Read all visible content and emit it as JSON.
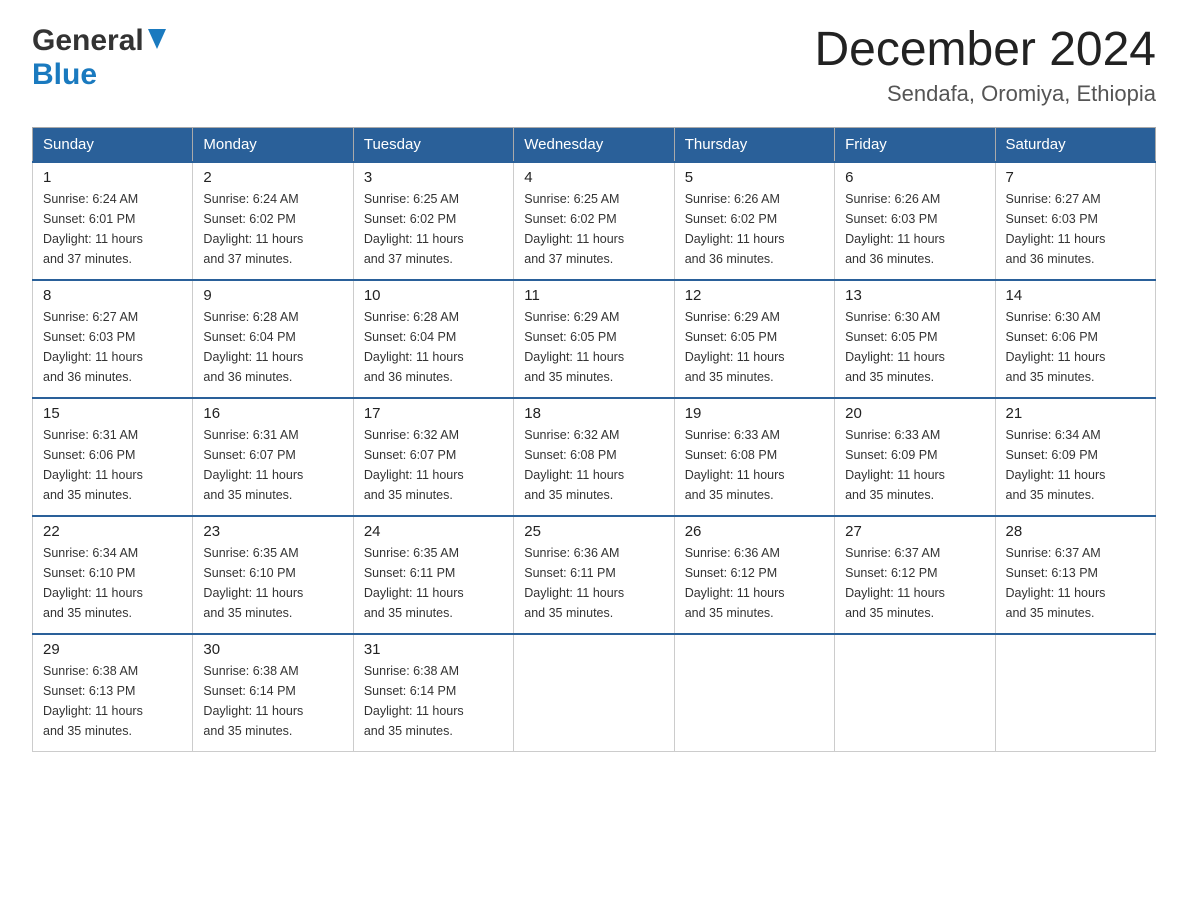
{
  "header": {
    "logo": {
      "general": "General",
      "blue": "Blue",
      "triangle_alt": "triangle logo"
    },
    "month_title": "December 2024",
    "location": "Sendafa, Oromiya, Ethiopia"
  },
  "days_of_week": [
    "Sunday",
    "Monday",
    "Tuesday",
    "Wednesday",
    "Thursday",
    "Friday",
    "Saturday"
  ],
  "weeks": [
    [
      {
        "day": "1",
        "sunrise": "6:24 AM",
        "sunset": "6:01 PM",
        "daylight": "11 hours and 37 minutes."
      },
      {
        "day": "2",
        "sunrise": "6:24 AM",
        "sunset": "6:02 PM",
        "daylight": "11 hours and 37 minutes."
      },
      {
        "day": "3",
        "sunrise": "6:25 AM",
        "sunset": "6:02 PM",
        "daylight": "11 hours and 37 minutes."
      },
      {
        "day": "4",
        "sunrise": "6:25 AM",
        "sunset": "6:02 PM",
        "daylight": "11 hours and 37 minutes."
      },
      {
        "day": "5",
        "sunrise": "6:26 AM",
        "sunset": "6:02 PM",
        "daylight": "11 hours and 36 minutes."
      },
      {
        "day": "6",
        "sunrise": "6:26 AM",
        "sunset": "6:03 PM",
        "daylight": "11 hours and 36 minutes."
      },
      {
        "day": "7",
        "sunrise": "6:27 AM",
        "sunset": "6:03 PM",
        "daylight": "11 hours and 36 minutes."
      }
    ],
    [
      {
        "day": "8",
        "sunrise": "6:27 AM",
        "sunset": "6:03 PM",
        "daylight": "11 hours and 36 minutes."
      },
      {
        "day": "9",
        "sunrise": "6:28 AM",
        "sunset": "6:04 PM",
        "daylight": "11 hours and 36 minutes."
      },
      {
        "day": "10",
        "sunrise": "6:28 AM",
        "sunset": "6:04 PM",
        "daylight": "11 hours and 36 minutes."
      },
      {
        "day": "11",
        "sunrise": "6:29 AM",
        "sunset": "6:05 PM",
        "daylight": "11 hours and 35 minutes."
      },
      {
        "day": "12",
        "sunrise": "6:29 AM",
        "sunset": "6:05 PM",
        "daylight": "11 hours and 35 minutes."
      },
      {
        "day": "13",
        "sunrise": "6:30 AM",
        "sunset": "6:05 PM",
        "daylight": "11 hours and 35 minutes."
      },
      {
        "day": "14",
        "sunrise": "6:30 AM",
        "sunset": "6:06 PM",
        "daylight": "11 hours and 35 minutes."
      }
    ],
    [
      {
        "day": "15",
        "sunrise": "6:31 AM",
        "sunset": "6:06 PM",
        "daylight": "11 hours and 35 minutes."
      },
      {
        "day": "16",
        "sunrise": "6:31 AM",
        "sunset": "6:07 PM",
        "daylight": "11 hours and 35 minutes."
      },
      {
        "day": "17",
        "sunrise": "6:32 AM",
        "sunset": "6:07 PM",
        "daylight": "11 hours and 35 minutes."
      },
      {
        "day": "18",
        "sunrise": "6:32 AM",
        "sunset": "6:08 PM",
        "daylight": "11 hours and 35 minutes."
      },
      {
        "day": "19",
        "sunrise": "6:33 AM",
        "sunset": "6:08 PM",
        "daylight": "11 hours and 35 minutes."
      },
      {
        "day": "20",
        "sunrise": "6:33 AM",
        "sunset": "6:09 PM",
        "daylight": "11 hours and 35 minutes."
      },
      {
        "day": "21",
        "sunrise": "6:34 AM",
        "sunset": "6:09 PM",
        "daylight": "11 hours and 35 minutes."
      }
    ],
    [
      {
        "day": "22",
        "sunrise": "6:34 AM",
        "sunset": "6:10 PM",
        "daylight": "11 hours and 35 minutes."
      },
      {
        "day": "23",
        "sunrise": "6:35 AM",
        "sunset": "6:10 PM",
        "daylight": "11 hours and 35 minutes."
      },
      {
        "day": "24",
        "sunrise": "6:35 AM",
        "sunset": "6:11 PM",
        "daylight": "11 hours and 35 minutes."
      },
      {
        "day": "25",
        "sunrise": "6:36 AM",
        "sunset": "6:11 PM",
        "daylight": "11 hours and 35 minutes."
      },
      {
        "day": "26",
        "sunrise": "6:36 AM",
        "sunset": "6:12 PM",
        "daylight": "11 hours and 35 minutes."
      },
      {
        "day": "27",
        "sunrise": "6:37 AM",
        "sunset": "6:12 PM",
        "daylight": "11 hours and 35 minutes."
      },
      {
        "day": "28",
        "sunrise": "6:37 AM",
        "sunset": "6:13 PM",
        "daylight": "11 hours and 35 minutes."
      }
    ],
    [
      {
        "day": "29",
        "sunrise": "6:38 AM",
        "sunset": "6:13 PM",
        "daylight": "11 hours and 35 minutes."
      },
      {
        "day": "30",
        "sunrise": "6:38 AM",
        "sunset": "6:14 PM",
        "daylight": "11 hours and 35 minutes."
      },
      {
        "day": "31",
        "sunrise": "6:38 AM",
        "sunset": "6:14 PM",
        "daylight": "11 hours and 35 minutes."
      },
      null,
      null,
      null,
      null
    ]
  ]
}
